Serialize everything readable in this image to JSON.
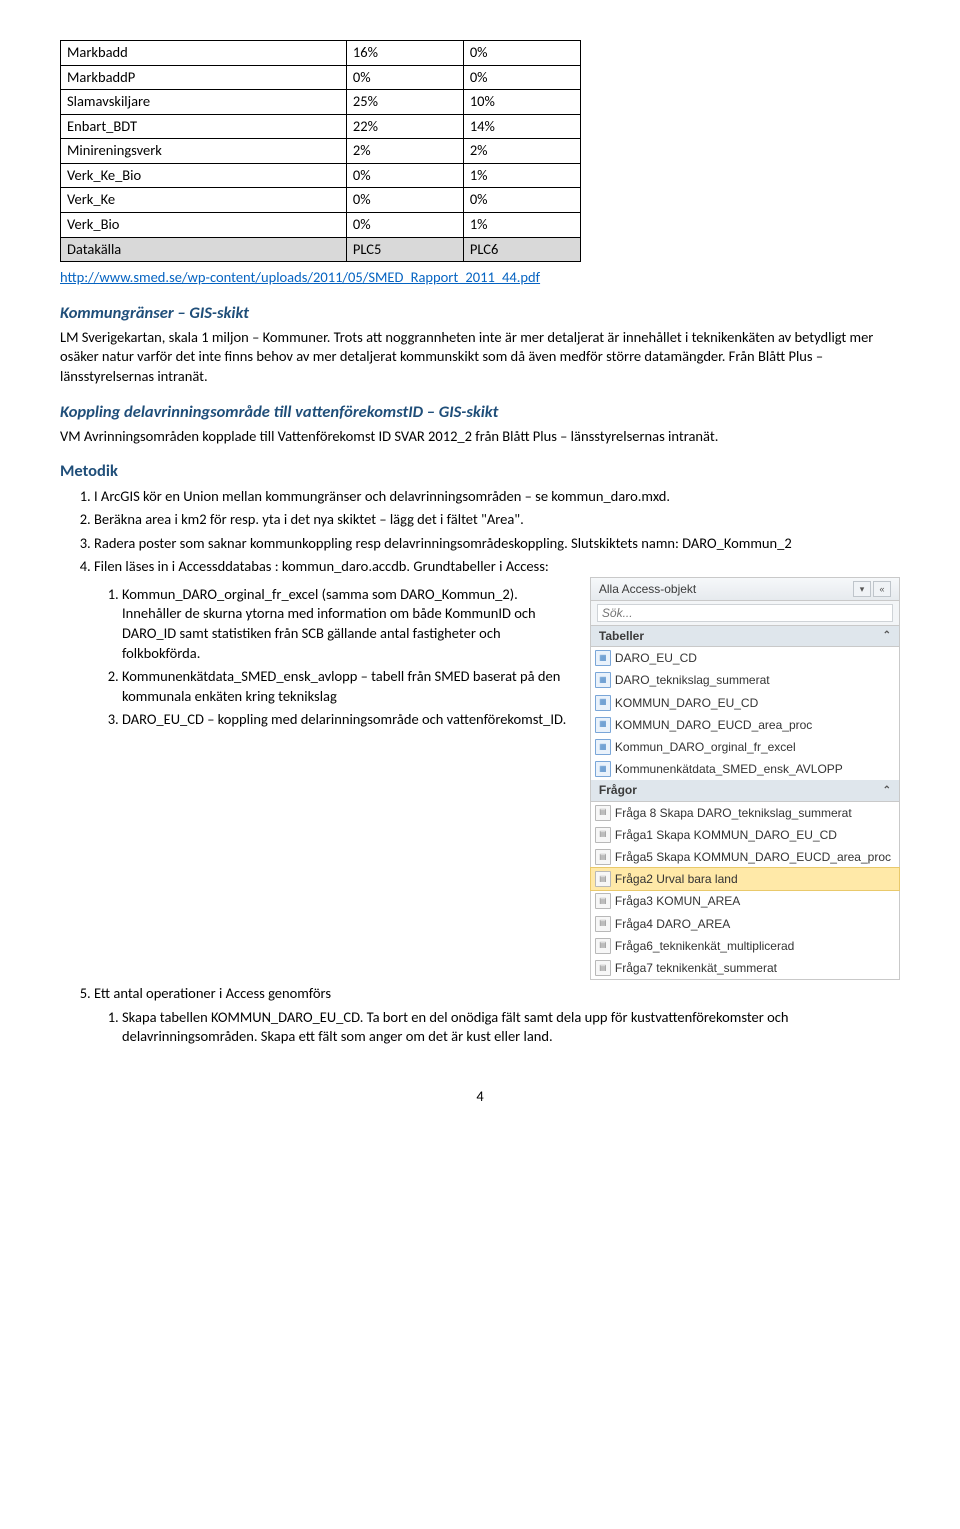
{
  "table": {
    "rows": [
      {
        "label": "Markbadd",
        "c1": "16%",
        "c2": "0%",
        "grey": false
      },
      {
        "label": "MarkbaddP",
        "c1": "0%",
        "c2": "0%",
        "grey": false
      },
      {
        "label": "Slamavskiljare",
        "c1": "25%",
        "c2": "10%",
        "grey": false
      },
      {
        "label": "Enbart_BDT",
        "c1": "22%",
        "c2": "14%",
        "grey": false
      },
      {
        "label": "Minireningsverk",
        "c1": "2%",
        "c2": "2%",
        "grey": false
      },
      {
        "label": "Verk_Ke_Bio",
        "c1": "0%",
        "c2": "1%",
        "grey": false
      },
      {
        "label": "Verk_Ke",
        "c1": "0%",
        "c2": "0%",
        "grey": false
      },
      {
        "label": "Verk_Bio",
        "c1": "0%",
        "c2": "1%",
        "grey": false
      },
      {
        "label": "Datakälla",
        "c1": "PLC5",
        "c2": "PLC6",
        "grey": true
      }
    ]
  },
  "link_url": "http://www.smed.se/wp-content/uploads/2011/05/SMED_Rapport_2011_44.pdf",
  "sections": {
    "kommungranser_title": "Kommungränser – GIS-skikt",
    "kommungranser_text": "LM Sverigekartan, skala 1 miljon – Kommuner. Trots att noggrannheten inte är mer detaljerat är innehållet i teknikenkäten av betydligt mer osäker natur varför det inte finns behov av mer detaljerat kommunskikt som då även medför större datamängder. Från Blått Plus – länsstyrelsernas intranät.",
    "koppling_title": "Koppling delavrinningsområde till vattenförekomstID – GIS-skikt",
    "koppling_text": "VM Avrinningsområden kopplade till Vattenförekomst ID SVAR 2012_2 från Blått Plus – länsstyrelsernas intranät.",
    "metodik_title": "Metodik"
  },
  "metodik": {
    "item1": "I ArcGIS kör en Union mellan kommungränser och delavrinningsområden – se kommun_daro.mxd.",
    "item2": "Beräkna area i km2 för resp. yta i det nya skiktet – lägg det i fältet \"Area\".",
    "item3": "Radera poster som saknar kommunkoppling resp delavrinningsområdeskoppling. Slutskiktets namn: DARO_Kommun_2",
    "item4": "Filen läses in i Accessddatabas : kommun_daro.accdb. Grundtabeller i Access:",
    "sub1": "Kommun_DARO_orginal_fr_excel (samma som DARO_Kommun_2). Innehåller de skurna ytorna med information om både KommunID och DARO_ID samt statistiken från SCB gällande antal fastigheter och folkbokförda.",
    "sub2": "Kommunenkätdata_SMED_ensk_avlopp – tabell från SMED baserat på den kommunala enkäten kring teknikslag",
    "sub3": "DARO_EU_CD – koppling med delarinningsområde och vattenförekomst_ID.",
    "item5": "Ett antal operationer i Access genomförs",
    "sub5_1": "Skapa tabellen KOMMUN_DARO_EU_CD. Ta bort en del onödiga fält samt dela upp för kustvattenförekomster och delavrinningsområden. Skapa ett fält som anger om det är kust eller land."
  },
  "access": {
    "header": "Alla Access-objekt",
    "search_placeholder": "Sök...",
    "group_tables": "Tabeller",
    "group_queries": "Frågor",
    "tables": [
      "DARO_EU_CD",
      "DARO_teknikslag_summerat",
      "KOMMUN_DARO_EU_CD",
      "KOMMUN_DARO_EUCD_area_proc",
      "Kommun_DARO_orginal_fr_excel",
      "Kommunenkätdata_SMED_ensk_AVLOPP"
    ],
    "queries": [
      {
        "label": "Fråga 8 Skapa DARO_teknikslag_summerat",
        "selected": false
      },
      {
        "label": "Fråga1 Skapa KOMMUN_DARO_EU_CD",
        "selected": false
      },
      {
        "label": "Fråga5 Skapa KOMMUN_DARO_EUCD_area_proc",
        "selected": false
      },
      {
        "label": "Fråga2 Urval bara land",
        "selected": true
      },
      {
        "label": "Fråga3 KOMUN_AREA",
        "selected": false
      },
      {
        "label": "Fråga4 DARO_AREA",
        "selected": false
      },
      {
        "label": "Fråga6_teknikenkät_multiplicerad",
        "selected": false
      },
      {
        "label": "Fråga7 teknikenkät_summerat",
        "selected": false
      }
    ]
  },
  "page_num": "4"
}
